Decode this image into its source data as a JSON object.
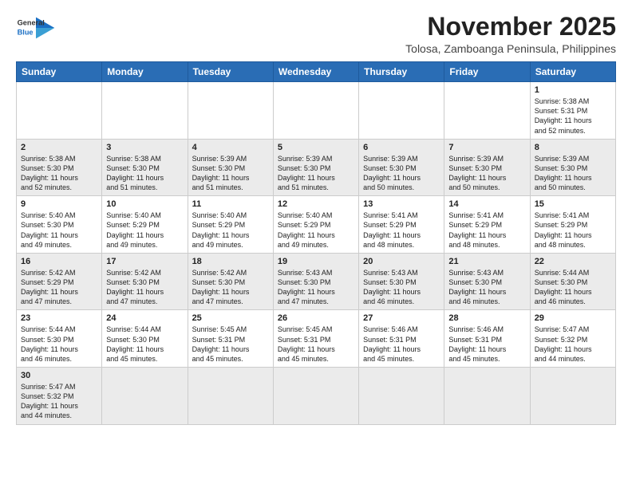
{
  "header": {
    "logo_line1": "General",
    "logo_line2": "Blue",
    "month_title": "November 2025",
    "location": "Tolosa, Zamboanga Peninsula, Philippines"
  },
  "weekdays": [
    "Sunday",
    "Monday",
    "Tuesday",
    "Wednesday",
    "Thursday",
    "Friday",
    "Saturday"
  ],
  "rows": [
    [
      {
        "date": "",
        "info": ""
      },
      {
        "date": "",
        "info": ""
      },
      {
        "date": "",
        "info": ""
      },
      {
        "date": "",
        "info": ""
      },
      {
        "date": "",
        "info": ""
      },
      {
        "date": "",
        "info": ""
      },
      {
        "date": "1",
        "info": "Sunrise: 5:38 AM\nSunset: 5:31 PM\nDaylight: 11 hours\nand 52 minutes."
      }
    ],
    [
      {
        "date": "2",
        "info": "Sunrise: 5:38 AM\nSunset: 5:30 PM\nDaylight: 11 hours\nand 52 minutes."
      },
      {
        "date": "3",
        "info": "Sunrise: 5:38 AM\nSunset: 5:30 PM\nDaylight: 11 hours\nand 51 minutes."
      },
      {
        "date": "4",
        "info": "Sunrise: 5:39 AM\nSunset: 5:30 PM\nDaylight: 11 hours\nand 51 minutes."
      },
      {
        "date": "5",
        "info": "Sunrise: 5:39 AM\nSunset: 5:30 PM\nDaylight: 11 hours\nand 51 minutes."
      },
      {
        "date": "6",
        "info": "Sunrise: 5:39 AM\nSunset: 5:30 PM\nDaylight: 11 hours\nand 50 minutes."
      },
      {
        "date": "7",
        "info": "Sunrise: 5:39 AM\nSunset: 5:30 PM\nDaylight: 11 hours\nand 50 minutes."
      },
      {
        "date": "8",
        "info": "Sunrise: 5:39 AM\nSunset: 5:30 PM\nDaylight: 11 hours\nand 50 minutes."
      }
    ],
    [
      {
        "date": "9",
        "info": "Sunrise: 5:40 AM\nSunset: 5:30 PM\nDaylight: 11 hours\nand 49 minutes."
      },
      {
        "date": "10",
        "info": "Sunrise: 5:40 AM\nSunset: 5:29 PM\nDaylight: 11 hours\nand 49 minutes."
      },
      {
        "date": "11",
        "info": "Sunrise: 5:40 AM\nSunset: 5:29 PM\nDaylight: 11 hours\nand 49 minutes."
      },
      {
        "date": "12",
        "info": "Sunrise: 5:40 AM\nSunset: 5:29 PM\nDaylight: 11 hours\nand 49 minutes."
      },
      {
        "date": "13",
        "info": "Sunrise: 5:41 AM\nSunset: 5:29 PM\nDaylight: 11 hours\nand 48 minutes."
      },
      {
        "date": "14",
        "info": "Sunrise: 5:41 AM\nSunset: 5:29 PM\nDaylight: 11 hours\nand 48 minutes."
      },
      {
        "date": "15",
        "info": "Sunrise: 5:41 AM\nSunset: 5:29 PM\nDaylight: 11 hours\nand 48 minutes."
      }
    ],
    [
      {
        "date": "16",
        "info": "Sunrise: 5:42 AM\nSunset: 5:29 PM\nDaylight: 11 hours\nand 47 minutes."
      },
      {
        "date": "17",
        "info": "Sunrise: 5:42 AM\nSunset: 5:30 PM\nDaylight: 11 hours\nand 47 minutes."
      },
      {
        "date": "18",
        "info": "Sunrise: 5:42 AM\nSunset: 5:30 PM\nDaylight: 11 hours\nand 47 minutes."
      },
      {
        "date": "19",
        "info": "Sunrise: 5:43 AM\nSunset: 5:30 PM\nDaylight: 11 hours\nand 47 minutes."
      },
      {
        "date": "20",
        "info": "Sunrise: 5:43 AM\nSunset: 5:30 PM\nDaylight: 11 hours\nand 46 minutes."
      },
      {
        "date": "21",
        "info": "Sunrise: 5:43 AM\nSunset: 5:30 PM\nDaylight: 11 hours\nand 46 minutes."
      },
      {
        "date": "22",
        "info": "Sunrise: 5:44 AM\nSunset: 5:30 PM\nDaylight: 11 hours\nand 46 minutes."
      }
    ],
    [
      {
        "date": "23",
        "info": "Sunrise: 5:44 AM\nSunset: 5:30 PM\nDaylight: 11 hours\nand 46 minutes."
      },
      {
        "date": "24",
        "info": "Sunrise: 5:44 AM\nSunset: 5:30 PM\nDaylight: 11 hours\nand 45 minutes."
      },
      {
        "date": "25",
        "info": "Sunrise: 5:45 AM\nSunset: 5:31 PM\nDaylight: 11 hours\nand 45 minutes."
      },
      {
        "date": "26",
        "info": "Sunrise: 5:45 AM\nSunset: 5:31 PM\nDaylight: 11 hours\nand 45 minutes."
      },
      {
        "date": "27",
        "info": "Sunrise: 5:46 AM\nSunset: 5:31 PM\nDaylight: 11 hours\nand 45 minutes."
      },
      {
        "date": "28",
        "info": "Sunrise: 5:46 AM\nSunset: 5:31 PM\nDaylight: 11 hours\nand 45 minutes."
      },
      {
        "date": "29",
        "info": "Sunrise: 5:47 AM\nSunset: 5:32 PM\nDaylight: 11 hours\nand 44 minutes."
      }
    ],
    [
      {
        "date": "30",
        "info": "Sunrise: 5:47 AM\nSunset: 5:32 PM\nDaylight: 11 hours\nand 44 minutes."
      },
      {
        "date": "",
        "info": ""
      },
      {
        "date": "",
        "info": ""
      },
      {
        "date": "",
        "info": ""
      },
      {
        "date": "",
        "info": ""
      },
      {
        "date": "",
        "info": ""
      },
      {
        "date": "",
        "info": ""
      }
    ]
  ]
}
